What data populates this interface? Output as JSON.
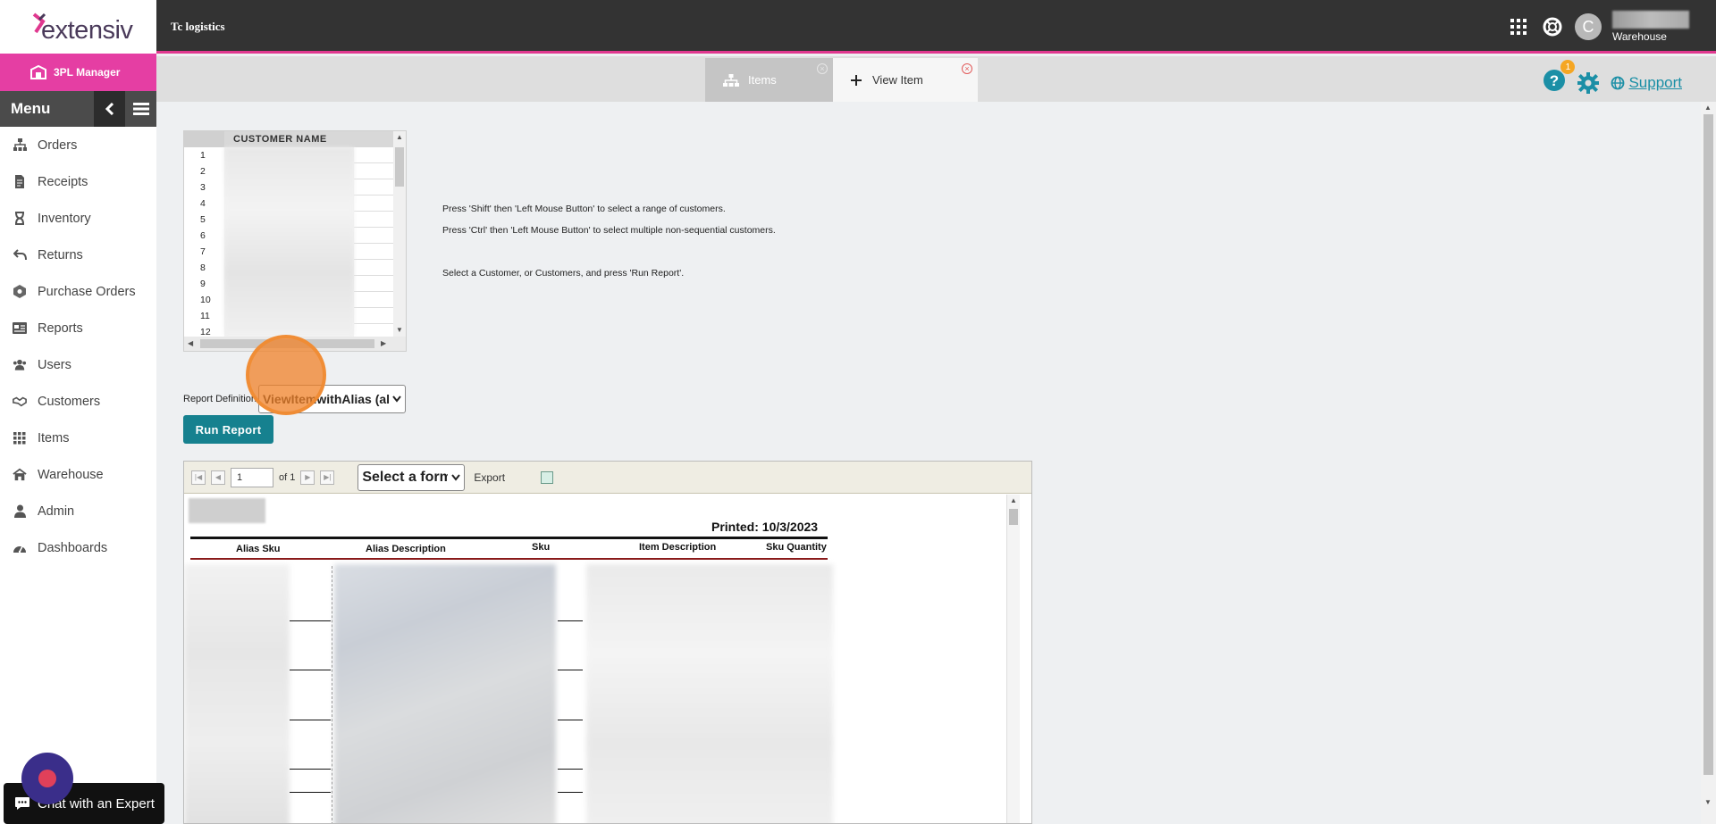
{
  "brand": {
    "logo_text": "extensiv",
    "company": "Tc logistics"
  },
  "user": {
    "avatar_letter": "C",
    "role": "Warehouse"
  },
  "app": {
    "badge": "3PL Manager"
  },
  "menu": {
    "title": "Menu",
    "items": [
      {
        "label": "Orders",
        "icon": "orders-icon"
      },
      {
        "label": "Receipts",
        "icon": "receipts-icon"
      },
      {
        "label": "Inventory",
        "icon": "inventory-icon"
      },
      {
        "label": "Returns",
        "icon": "returns-icon"
      },
      {
        "label": "Purchase Orders",
        "icon": "purchase-orders-icon"
      },
      {
        "label": "Reports",
        "icon": "reports-icon"
      },
      {
        "label": "Users",
        "icon": "users-icon"
      },
      {
        "label": "Customers",
        "icon": "customers-icon"
      },
      {
        "label": "Items",
        "icon": "items-icon"
      },
      {
        "label": "Warehouse",
        "icon": "warehouse-icon"
      },
      {
        "label": "Admin",
        "icon": "admin-icon"
      },
      {
        "label": "Dashboards",
        "icon": "dashboards-icon"
      }
    ]
  },
  "tabs": [
    {
      "label": "Items",
      "active": false
    },
    {
      "label": "View Item",
      "active": true
    }
  ],
  "header_tools": {
    "help_badge": "1",
    "support_label": "Support"
  },
  "customer_grid": {
    "column_header": "CUSTOMER NAME",
    "row_numbers": [
      "1",
      "2",
      "3",
      "4",
      "5",
      "6",
      "7",
      "8",
      "9",
      "10",
      "11",
      "12"
    ]
  },
  "instructions": {
    "shift": "Press 'Shift' then 'Left Mouse Button' to select a range of customers.",
    "ctrl": "Press 'Ctrl' then 'Left Mouse Button' to select multiple non-sequential customers.",
    "select": "Select a Customer, or Customers, and press 'Run Report'."
  },
  "report_definition": {
    "label": "Report Definition",
    "selected": "ViewItemwithAlias (al"
  },
  "run_report_label": "Run Report",
  "viewer": {
    "page_value": "1",
    "page_of": "of 1",
    "format_placeholder": "Select a form",
    "export_label": "Export"
  },
  "report": {
    "printed": "Printed: 10/3/2023",
    "columns": [
      "Alias Sku",
      "Alias Description",
      "Sku",
      "Item Description",
      "Sku Quantity"
    ]
  },
  "chat": {
    "label": "Chat with an Expert"
  },
  "colors": {
    "topbar": "#333333",
    "accent_pink": "#e53ea3",
    "teal": "#16818f",
    "marker_orange": "#f0822a"
  }
}
